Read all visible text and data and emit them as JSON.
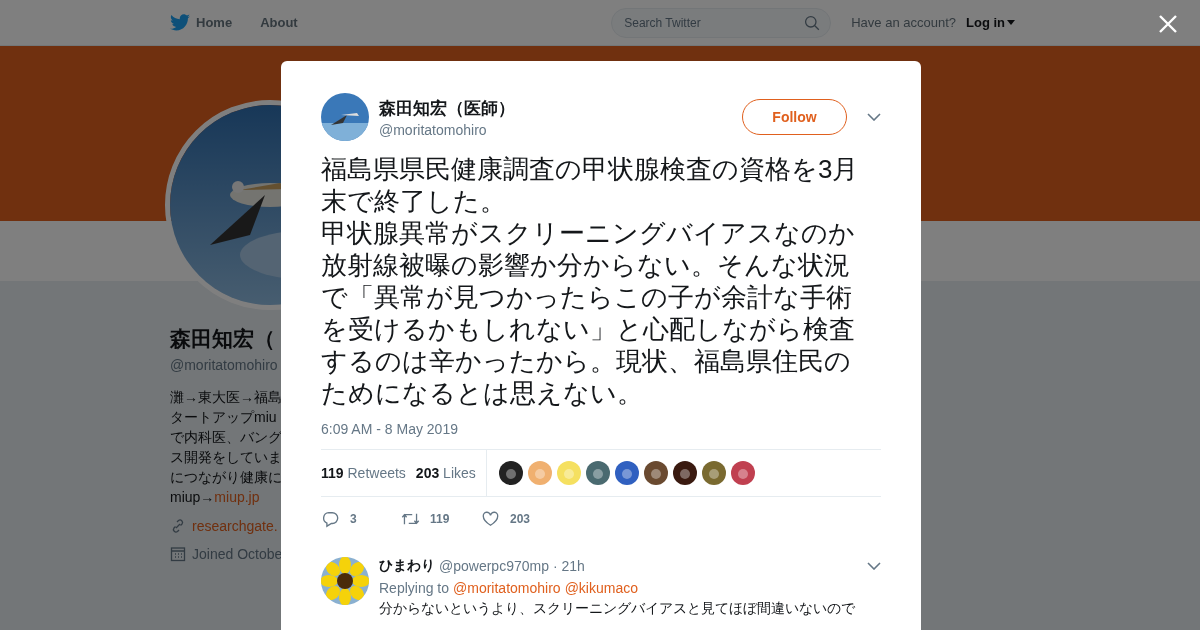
{
  "nav": {
    "items": [
      {
        "label": "Home",
        "kind": "home"
      },
      {
        "label": "About",
        "kind": "plain"
      }
    ],
    "search": {
      "placeholder": "Search Twitter"
    },
    "account_prompt": "Have an account?",
    "login": "Log in"
  },
  "profile": {
    "name": "森田知宏（",
    "handle": "@moritatomohiro",
    "bio_lines": [
      {
        "text": "灘→東大医→福島"
      },
      {
        "text": "タートアップmiu"
      },
      {
        "text": "で内科医、バング"
      },
      {
        "text": "ス開発をしていま"
      },
      {
        "text": "につながり健康に"
      },
      {
        "text": "miup→",
        "link": "miup.jp"
      }
    ],
    "website": "researchgate.",
    "joined": "Joined Octobe"
  },
  "tweet": {
    "author": "森田知宏（医師）",
    "handle": "@moritatomohiro",
    "follow": "Follow",
    "paragraphs": [
      "福島県県民健康調査の甲状腺検査の資格を3月末で終了した。",
      "甲状腺異常がスクリーニングバイアスなのか放射線被曝の影響か分からない。そんな状況で「異常が見つかったらこの子が余計な手術を受けるかもしれない」と心配しながら検査するのは辛かったから。現状、福島県住民のためになるとは思えない。"
    ],
    "time": "6:09 AM - 8 May 2019",
    "stats": [
      {
        "count": "119",
        "label": "Retweets"
      },
      {
        "count": "203",
        "label": "Likes"
      }
    ],
    "likers": [
      {
        "color": "#222222"
      },
      {
        "color": "#f0b070"
      },
      {
        "color": "#f5e060"
      },
      {
        "color": "#4a6a70"
      },
      {
        "color": "#3060c0"
      },
      {
        "color": "#6a4a30"
      },
      {
        "color": "#3a1a10"
      },
      {
        "color": "#7a6a30"
      },
      {
        "color": "#c04050"
      }
    ],
    "actions": [
      {
        "kind": "reply",
        "count": "3"
      },
      {
        "kind": "retweet",
        "count": "119"
      },
      {
        "kind": "like",
        "count": "203"
      }
    ]
  },
  "reply": {
    "author": "ひまわり",
    "handle": "@powerpc970mp",
    "time": "· 21h",
    "replying_to": "Replying to",
    "mentions": [
      "@moritatomohiro",
      "@kikumaco"
    ],
    "text": "分からないというより、スクリーニングバイアスと見てほぼ間違いないので"
  }
}
